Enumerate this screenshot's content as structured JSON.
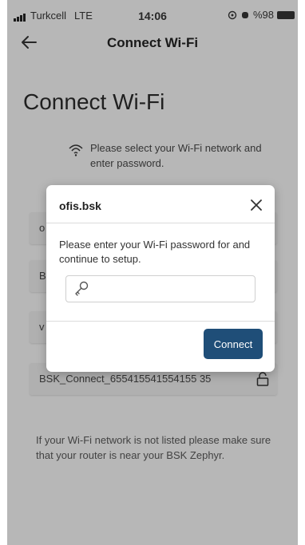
{
  "status_bar": {
    "carrier": "Turkcell",
    "network": "LTE",
    "time": "14:06",
    "battery": "%98",
    "icons": [
      "signal-bars-icon",
      "location-icon",
      "alarm-icon",
      "battery-icon"
    ]
  },
  "nav": {
    "back_icon": "arrow-left-icon",
    "title": "Connect Wi-Fi"
  },
  "page": {
    "heading": "Connect Wi-Fi",
    "intro": "Please select your Wi-Fi network and enter password.",
    "intro_icon": "wifi-icon"
  },
  "networks": [
    {
      "label": "o",
      "icon": "lock-icon"
    },
    {
      "label": "B",
      "icon": "lock-icon"
    },
    {
      "label": "v",
      "icon": "lock-icon"
    },
    {
      "label": "BSK_Connect_655415541554155 35",
      "icon": "lock-icon"
    }
  ],
  "footer_note": "If your Wi-Fi network is not listed please make sure that your router is near your BSK Zephyr.",
  "dialog": {
    "title": "ofis.bsk",
    "close_icon": "close-icon",
    "message": "Please enter your Wi-Fi password for and continue to setup.",
    "password": {
      "value": "",
      "placeholder": "",
      "icon": "key-icon"
    },
    "connect_label": "Connect"
  },
  "colors": {
    "background": "#ebebeb",
    "accent": "#1f4e78",
    "dialog": "#ffffff"
  }
}
